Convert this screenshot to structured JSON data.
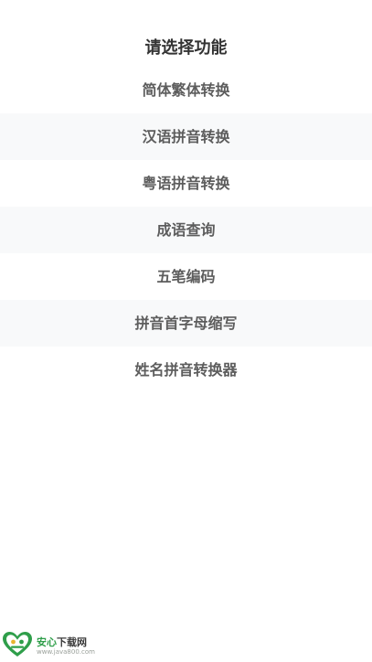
{
  "page": {
    "title": "请选择功能"
  },
  "menu": {
    "items": [
      {
        "label": "简体繁体转换"
      },
      {
        "label": "汉语拼音转换"
      },
      {
        "label": "粤语拼音转换"
      },
      {
        "label": "成语查询"
      },
      {
        "label": "五笔编码"
      },
      {
        "label": "拼音首字母缩写"
      },
      {
        "label": "姓名拼音转换器"
      }
    ]
  },
  "watermark": {
    "brand_green": "安心",
    "brand_dark": "下载网",
    "url": "www.java800.com",
    "accent_color": "#2f9e4a"
  }
}
